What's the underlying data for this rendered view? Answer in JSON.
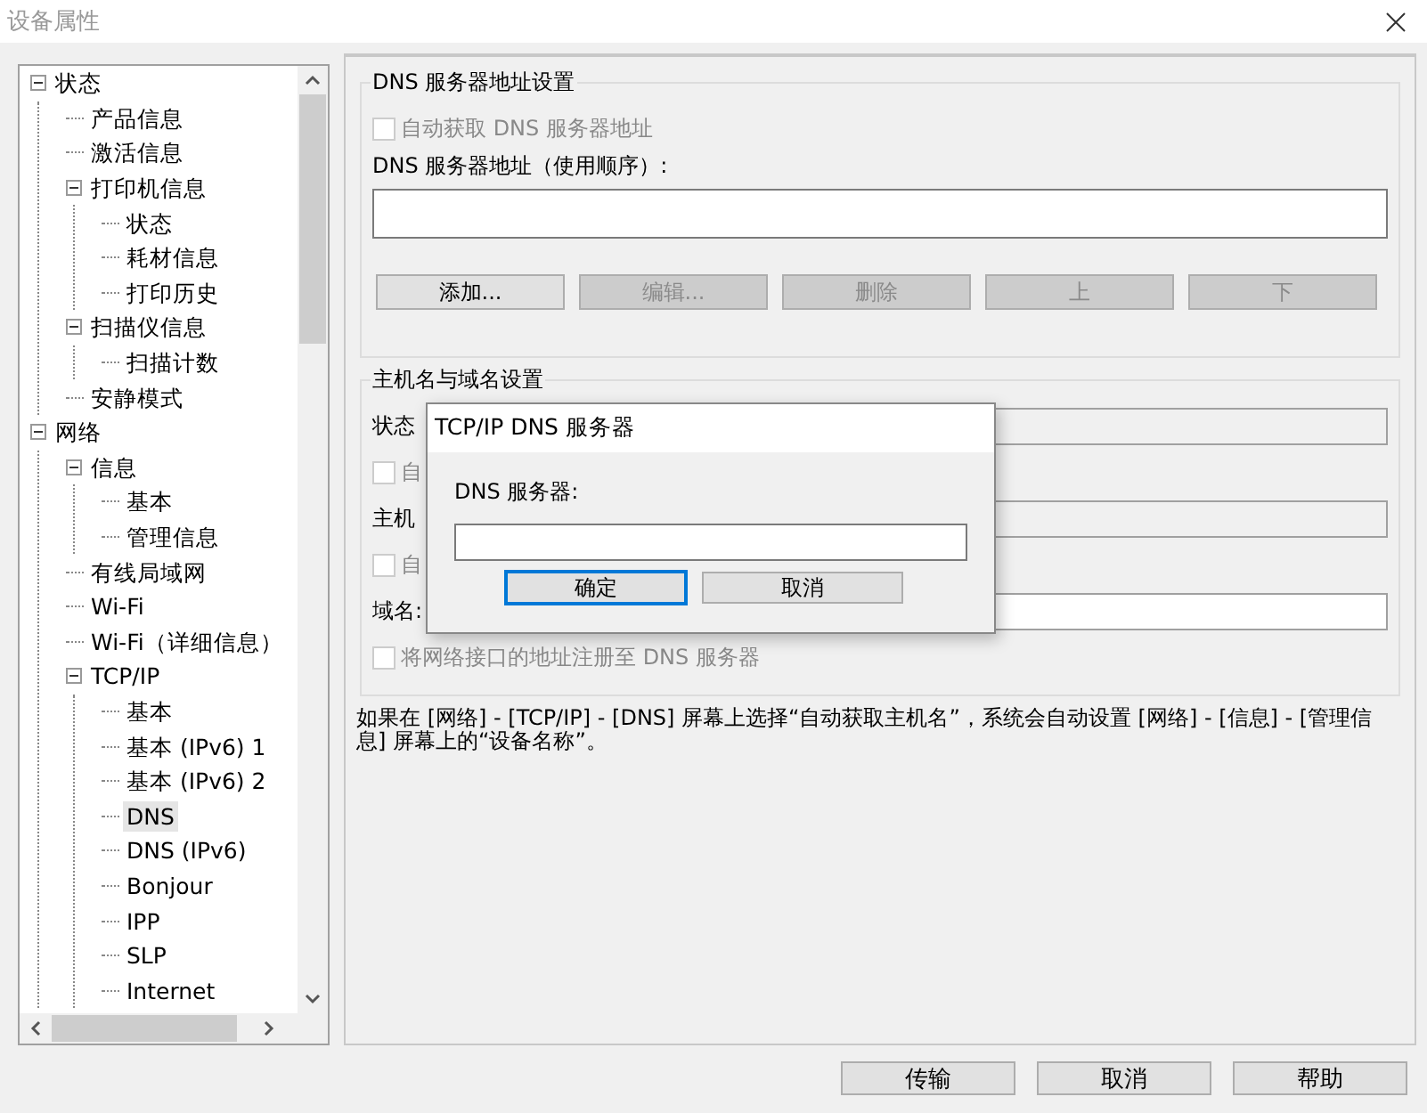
{
  "window": {
    "title": "设备属性"
  },
  "tree": [
    {
      "label": "状态",
      "expanded": true,
      "selected": false,
      "children": [
        {
          "label": "产品信息",
          "selected": false
        },
        {
          "label": "激活信息",
          "selected": false
        },
        {
          "label": "打印机信息",
          "expanded": true,
          "selected": false,
          "children": [
            {
              "label": "状态",
              "selected": false
            },
            {
              "label": "耗材信息",
              "selected": false
            },
            {
              "label": "打印历史",
              "selected": false
            }
          ]
        },
        {
          "label": "扫描仪信息",
          "expanded": true,
          "selected": false,
          "children": [
            {
              "label": "扫描计数",
              "selected": false
            }
          ]
        },
        {
          "label": "安静模式",
          "selected": false
        }
      ]
    },
    {
      "label": "网络",
      "expanded": true,
      "selected": false,
      "children": [
        {
          "label": "信息",
          "expanded": true,
          "selected": false,
          "children": [
            {
              "label": "基本",
              "selected": false
            },
            {
              "label": "管理信息",
              "selected": false
            }
          ]
        },
        {
          "label": "有线局域网",
          "selected": false
        },
        {
          "label": "Wi-Fi",
          "selected": false
        },
        {
          "label": "Wi-Fi（详细信息）",
          "selected": false
        },
        {
          "label": "TCP/IP",
          "expanded": true,
          "selected": false,
          "children": [
            {
              "label": "基本",
              "selected": false
            },
            {
              "label": "基本 (IPv6) 1",
              "selected": false
            },
            {
              "label": "基本 (IPv6) 2",
              "selected": false
            },
            {
              "label": "DNS",
              "selected": true
            },
            {
              "label": "DNS (IPv6)",
              "selected": false
            },
            {
              "label": "Bonjour",
              "selected": false
            },
            {
              "label": "IPP",
              "selected": false
            },
            {
              "label": "SLP",
              "selected": false
            },
            {
              "label": "Internet",
              "selected": false
            }
          ]
        }
      ]
    }
  ],
  "dns_group": {
    "title": "DNS 服务器地址设置",
    "auto_checkbox": {
      "label": "自动获取 DNS 服务器地址",
      "checked": false,
      "disabled": true
    },
    "list_label": "DNS 服务器地址（使用顺序）:",
    "buttons": [
      {
        "label": "添加...",
        "disabled": false
      },
      {
        "label": "编辑...",
        "disabled": true
      },
      {
        "label": "删除",
        "disabled": true
      },
      {
        "label": "上",
        "disabled": true
      },
      {
        "label": "下",
        "disabled": true
      }
    ]
  },
  "host_group": {
    "title": "主机名与域名设置",
    "rows": [
      {
        "kind": "field",
        "label": "状态",
        "disabled": true
      },
      {
        "kind": "checkbox",
        "label": "自",
        "checked": false,
        "disabled": true
      },
      {
        "kind": "field",
        "label": "主机",
        "disabled": true
      },
      {
        "kind": "checkbox",
        "label": "自",
        "checked": false,
        "disabled": true
      },
      {
        "kind": "field",
        "label": "域名:",
        "disabled": false
      },
      {
        "kind": "checkbox",
        "label": "将网络接口的地址注册至 DNS 服务器",
        "checked": false,
        "disabled": true
      }
    ]
  },
  "note": "如果在 [网络] - [TCP/IP] - [DNS] 屏幕上选择“自动获取主机名”，系统会自动设置 [网络] - [信息] - [管理信息] 屏幕上的“设备名称”。",
  "dialog": {
    "title": "TCP/IP DNS 服务器",
    "label": "DNS 服务器:",
    "buttons": [
      {
        "label": "确定",
        "focused": true
      },
      {
        "label": "取消",
        "focused": false
      }
    ]
  },
  "footer_buttons": [
    "传输",
    "取消",
    "帮助"
  ]
}
